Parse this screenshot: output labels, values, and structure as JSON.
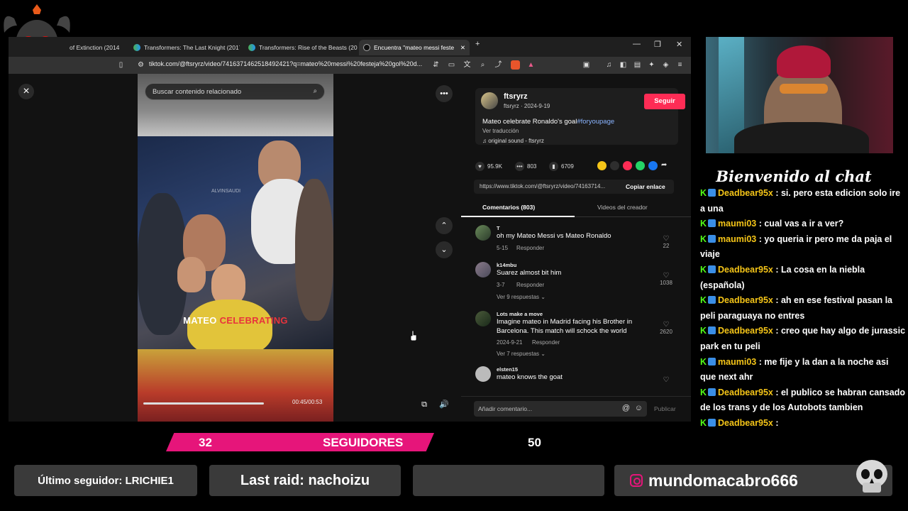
{
  "browser": {
    "tabs": [
      {
        "label": "of Extinction (2014"
      },
      {
        "label": "Transformers: The Last Knight (2017)"
      },
      {
        "label": "Transformers: Rise of the Beasts (202"
      },
      {
        "label": "Encuentra \"mateo messi feste"
      }
    ],
    "new_tab": "+",
    "url": "tiktok.com/@ftsryrz/video/7416371462518492421?q=mateo%20messi%20festeja%20gol%20d..."
  },
  "video": {
    "search_placeholder": "Buscar contenido relacionado",
    "caption_word1": "MATEO",
    "caption_word2": "CELEBRATING",
    "watermark": "ALVINSAUDI",
    "time": "00:45/00:53",
    "progress_fraction": 0.85
  },
  "post": {
    "username": "ftsryrz",
    "meta": "ftsryrz · 2024-9-19",
    "follow_label": "Seguir",
    "description": "Mateo celebrate Ronaldo's goal",
    "hashtag": "#foryoupage",
    "translate": "Ver traducción",
    "sound": "original sound - ftsryrz",
    "likes": "95.9K",
    "comments": "803",
    "saves": "6709",
    "link": "https://www.tiktok.com/@ftsryrz/video/74163714...",
    "copy_link": "Copiar enlace",
    "tab_comments": "Comentarios (803)",
    "tab_creator": "Videos del creador",
    "comment_placeholder": "Añadir comentario...",
    "publish": "Publicar"
  },
  "comments": [
    {
      "user": "T",
      "text": "oh my Mateo Messi vs Mateo Ronaldo",
      "date": "5-15",
      "reply": "Responder",
      "likes": "22",
      "more": ""
    },
    {
      "user": "k14mbu",
      "text": "Suarez almost bit him",
      "date": "3-7",
      "reply": "Responder",
      "likes": "1038",
      "more": "Ver 9 respuestas"
    },
    {
      "user": "Lots make a move",
      "text": "Imagine mateo in Madrid facing his Brother in Barcelona. This match will schock the world",
      "date": "2024-9-21",
      "reply": "Responder",
      "likes": "2620",
      "more": "Ver 7 respuestas"
    },
    {
      "user": "elsten15",
      "text": "mateo knows the goat",
      "date": "",
      "reply": "",
      "likes": "",
      "more": ""
    }
  ],
  "stream": {
    "chat_title": "Bienvenido al chat",
    "chat": [
      {
        "name": "Deadbear95x",
        "text": ": si. pero esta edicion solo ire a una"
      },
      {
        "name": "maumi03",
        "text": ": cual vas a ir a ver?"
      },
      {
        "name": "maumi03",
        "text": ": yo queria ir pero me da paja el viaje"
      },
      {
        "name": "Deadbear95x",
        "text": ": La cosa en la niebla (española)"
      },
      {
        "name": "Deadbear95x",
        "text": ": ah en ese festival pasan la peli paraguaya no entres"
      },
      {
        "name": "Deadbear95x",
        "text": ": creo que hay algo de jurassic park en tu peli"
      },
      {
        "name": "maumi03",
        "text": ": me fije y la dan a la noche asi que next ahr"
      },
      {
        "name": "Deadbear95x",
        "text": ": el publico se habran cansado de los trans y de los Autobots tambien"
      },
      {
        "name": "Deadbear95x",
        "text": ":"
      }
    ],
    "follower_count": "32",
    "follower_label": "SEGUIDORES",
    "follower_goal": "50",
    "last_follower": "Último seguidor: LRICHIE1",
    "last_raid": "Last raid: nachoizu",
    "social": "mundomacabro666"
  },
  "colors": {
    "accent": "#fe2c55",
    "stream_pink": "#e6157a",
    "chat_name": "#f5c518",
    "kick_green": "#53fc18"
  }
}
